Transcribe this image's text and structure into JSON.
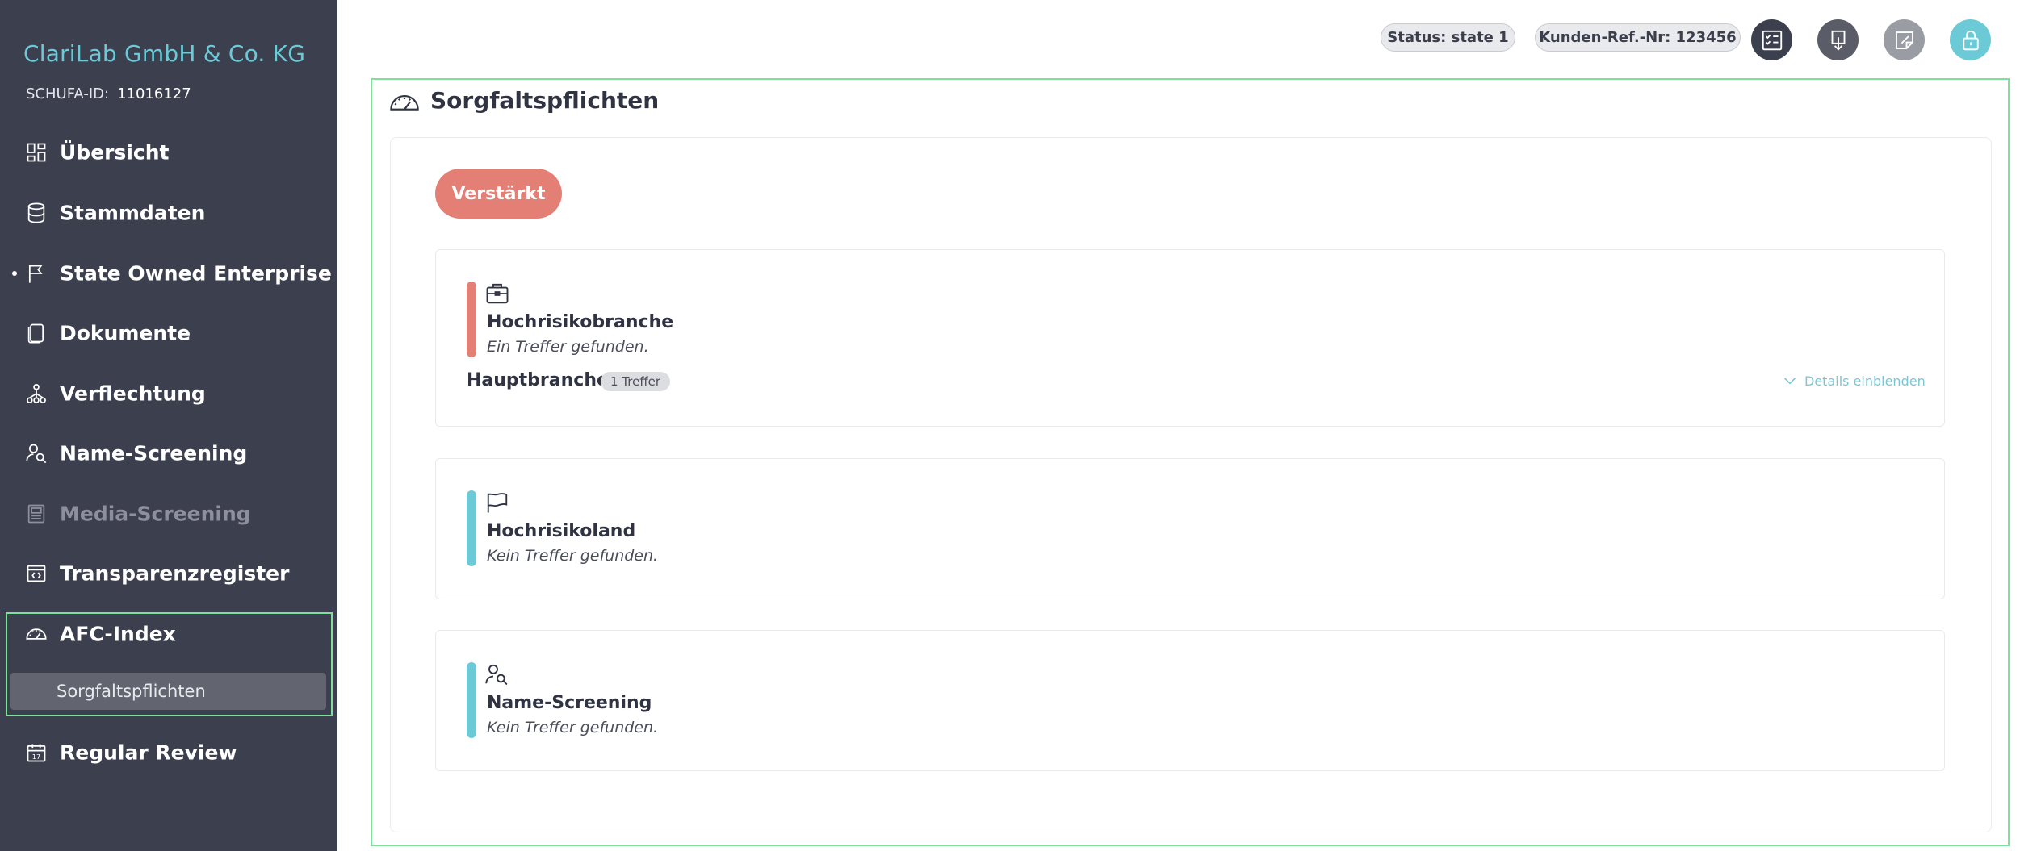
{
  "sidebar": {
    "company": "ClariLab GmbH & Co. KG",
    "schufa_label": "SCHUFA-ID:",
    "schufa_id": "11016127",
    "items": [
      {
        "label": "Übersicht",
        "icon": "dashboard-icon"
      },
      {
        "label": "Stammdaten",
        "icon": "database-icon"
      },
      {
        "label": "State Owned Enterprise",
        "icon": "flag-icon"
      },
      {
        "label": "Dokumente",
        "icon": "documents-icon"
      },
      {
        "label": "Verflechtung",
        "icon": "network-icon"
      },
      {
        "label": "Name-Screening",
        "icon": "person-search-icon"
      },
      {
        "label": "Media-Screening",
        "icon": "newspaper-icon"
      },
      {
        "label": "Transparenzregister",
        "icon": "code-window-icon"
      },
      {
        "label": "AFC-Index",
        "icon": "gauge-icon"
      },
      {
        "label": "Regular Review",
        "icon": "calendar-icon"
      }
    ],
    "sub_item": "Sorgfaltspflichten"
  },
  "topbar": {
    "status": "Status: state 1",
    "ref": "Kunden-Ref.-Nr: 123456"
  },
  "main": {
    "title": "Sorgfaltspflichten",
    "level": "Verstärkt",
    "cards": [
      {
        "title": "Hochrisikobranche",
        "subtitle": "Ein Treffer gefunden.",
        "color": "#e47f76"
      },
      {
        "title": "Hochrisikoland",
        "subtitle": "Kein Treffer gefunden.",
        "color": "#6ccad6"
      },
      {
        "title": "Name-Screening",
        "subtitle": "Kein Treffer gefunden.",
        "color": "#6ccad6"
      }
    ],
    "hauptbranche": "Hauptbranche",
    "treffer": "1 Treffer",
    "details": "Details einblenden"
  },
  "colors": {
    "sidebar_bg": "#3c3f4e",
    "accent_teal": "#6ccad6",
    "accent_red": "#e47f76",
    "highlight_green": "#7fe09a"
  }
}
